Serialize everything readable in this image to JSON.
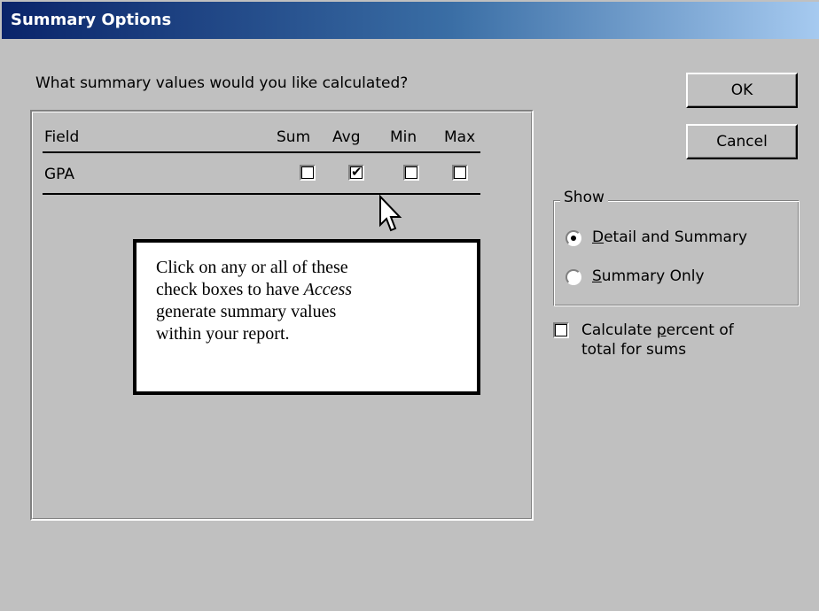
{
  "window": {
    "title": "Summary Options"
  },
  "prompt": "What summary values would you like calculated?",
  "grid": {
    "columns": {
      "field": "Field",
      "sum": "Sum",
      "avg": "Avg",
      "min": "Min",
      "max": "Max"
    },
    "rows": [
      {
        "field": "GPA",
        "sum": false,
        "avg": true,
        "min": false,
        "max": false
      }
    ]
  },
  "buttons": {
    "ok": "OK",
    "cancel": "Cancel"
  },
  "show_group": {
    "legend": "Show",
    "options": [
      {
        "prefix": "",
        "accel": "D",
        "rest": "etail and Summary",
        "selected": true
      },
      {
        "prefix": "",
        "accel": "S",
        "rest": "ummary Only",
        "selected": false
      }
    ]
  },
  "percent_option": {
    "line1_prefix": "Calculate ",
    "line1_accel": "p",
    "line1_rest": "ercent of",
    "line2": "total for sums",
    "checked": false
  },
  "callout": {
    "line1": "Click on any or all of these",
    "line2_prefix": "check boxes to have ",
    "line2_italic": "Access",
    "line3": "generate summary values",
    "line4": "within your report."
  },
  "icons": {
    "cursor": "mouse-pointer-icon",
    "checkmark": "checkmark-icon"
  }
}
